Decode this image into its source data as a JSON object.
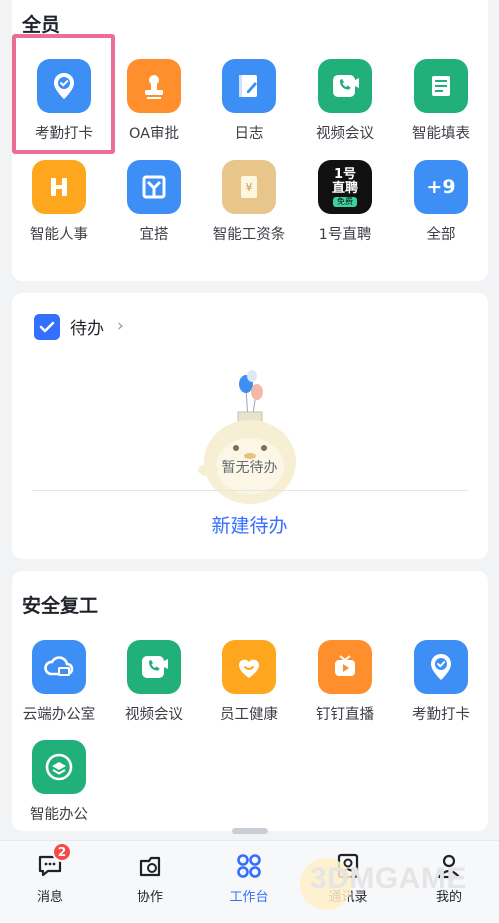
{
  "section_all": {
    "title": "全员"
  },
  "apps_all": [
    {
      "label": "考勤打卡",
      "icon": "location-check-icon",
      "color": "#3d8ef5"
    },
    {
      "label": "OA审批",
      "icon": "stamp-icon",
      "color": "#ff8f2c"
    },
    {
      "label": "日志",
      "icon": "notebook-pen-icon",
      "color": "#3d8ef5"
    },
    {
      "label": "视频会议",
      "icon": "video-call-icon",
      "color": "#22b07a"
    },
    {
      "label": "智能填表",
      "icon": "form-list-icon",
      "color": "#22b07a"
    },
    {
      "label": "智能人事",
      "icon": "hr-h-icon",
      "color": "#ffa61f"
    },
    {
      "label": "宜搭",
      "icon": "yida-icon",
      "color": "#3d8ef5"
    },
    {
      "label": "智能工资条",
      "icon": "salary-slip-icon",
      "color": "#e8c58b"
    },
    {
      "label": "1号直聘",
      "icon": "recruit-icon",
      "color": "#111111",
      "icon_text_top": "1号",
      "icon_text_mid": "直聘",
      "icon_text_tag": "免费"
    },
    {
      "label": "全部",
      "icon": "more-apps-icon",
      "color": "#3d8ef5",
      "icon_text": "+9"
    }
  ],
  "todo": {
    "title": "待办",
    "empty_text": "暂无待办",
    "new_label": "新建待办"
  },
  "section_safe": {
    "title": "安全复工"
  },
  "apps_safe": [
    {
      "label": "云端办公室",
      "icon": "cloud-office-icon",
      "color": "#3d8ef5"
    },
    {
      "label": "视频会议",
      "icon": "video-call-icon",
      "color": "#22b07a"
    },
    {
      "label": "员工健康",
      "icon": "heart-smile-icon",
      "color": "#ffa61f"
    },
    {
      "label": "钉钉直播",
      "icon": "live-tv-icon",
      "color": "#ff8f2c"
    },
    {
      "label": "考勤打卡",
      "icon": "location-check-icon",
      "color": "#3d8ef5"
    },
    {
      "label": "智能办公",
      "icon": "smart-office-icon",
      "color": "#22b07a"
    }
  ],
  "tabbar": {
    "items": [
      {
        "label": "消息",
        "icon": "message-icon",
        "badge": "2"
      },
      {
        "label": "协作",
        "icon": "collab-icon"
      },
      {
        "label": "工作台",
        "icon": "workbench-icon",
        "active": true
      },
      {
        "label": "通讯录",
        "icon": "contacts-icon"
      },
      {
        "label": "我的",
        "icon": "profile-icon"
      }
    ]
  },
  "colors": {
    "accent": "#3370ff",
    "badge": "#f54a45"
  },
  "watermark": "3DMGAME"
}
